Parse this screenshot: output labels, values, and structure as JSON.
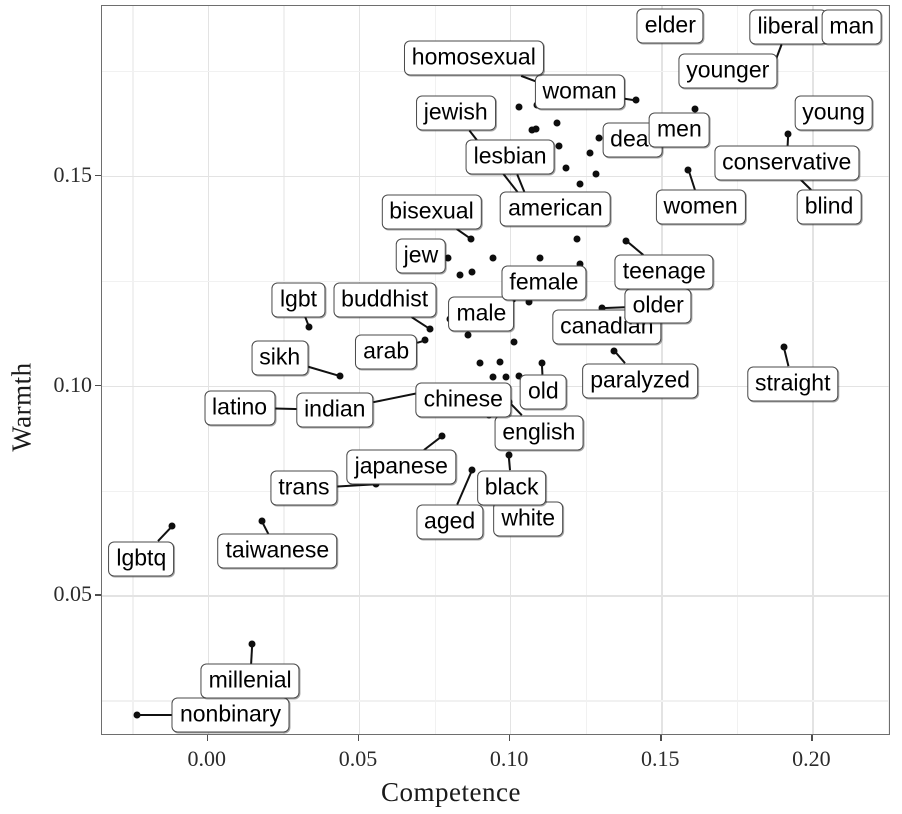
{
  "chart_data": {
    "type": "scatter",
    "title": "",
    "xlabel": "Competence",
    "ylabel": "Warmth",
    "xlim": [
      -0.035,
      0.226
    ],
    "ylim": [
      0.0165,
      0.1905
    ],
    "xticks": [
      "0.00",
      "0.05",
      "0.10",
      "0.15",
      "0.20"
    ],
    "xtick_values": [
      0.0,
      0.05,
      0.1,
      0.15,
      0.2
    ],
    "yticks": [
      "0.05",
      "0.10",
      "0.15"
    ],
    "ytick_values": [
      0.05,
      0.1,
      0.15
    ],
    "grid": "major and minor, light gray",
    "legend": "none",
    "point_color": "#0d0d0d",
    "label_box_color": "#ffffff",
    "label_border_color": "#4a4a4a",
    "points": [
      {
        "label": "nonbinary",
        "x": -0.0235,
        "y": 0.0215,
        "lx": 0.0075,
        "ly": 0.0215
      },
      {
        "label": "millenial",
        "x": 0.0147,
        "y": 0.0385,
        "lx": 0.014,
        "ly": 0.0295
      },
      {
        "label": "lgbtq",
        "x": -0.0118,
        "y": 0.0665,
        "lx": -0.022,
        "ly": 0.0588
      },
      {
        "label": "taiwanese",
        "x": 0.0178,
        "y": 0.0678,
        "lx": 0.023,
        "ly": 0.0605
      },
      {
        "label": "trans",
        "x": 0.0557,
        "y": 0.0765,
        "lx": 0.0318,
        "ly": 0.0755
      },
      {
        "label": "aged",
        "x": 0.0875,
        "y": 0.08,
        "lx": 0.08,
        "ly": 0.0675
      },
      {
        "label": "japanese",
        "x": 0.0775,
        "y": 0.088,
        "lx": 0.064,
        "ly": 0.0805
      },
      {
        "label": "white",
        "x": 0.0985,
        "y": 0.079,
        "lx": 0.106,
        "ly": 0.0682
      },
      {
        "label": "black",
        "x": 0.0995,
        "y": 0.0835,
        "lx": 0.1005,
        "ly": 0.0757
      },
      {
        "label": "english",
        "x": 0.0998,
        "y": 0.096,
        "lx": 0.1095,
        "ly": 0.0888
      },
      {
        "label": "chinese",
        "x": 0.093,
        "y": 0.093,
        "lx": 0.0845,
        "ly": 0.0965
      },
      {
        "label": "indian",
        "x": 0.0762,
        "y": 0.0992,
        "lx": 0.042,
        "ly": 0.0942
      },
      {
        "label": "latino",
        "x": 0.042,
        "y": 0.0942,
        "lx": 0.0105,
        "ly": 0.0948
      },
      {
        "label": "sikh",
        "x": 0.0437,
        "y": 0.1023,
        "lx": 0.0238,
        "ly": 0.1065
      },
      {
        "label": "lgbt",
        "x": 0.0335,
        "y": 0.114,
        "lx": 0.03,
        "ly": 0.1205
      },
      {
        "label": "arab",
        "x": 0.072,
        "y": 0.1108,
        "lx": 0.059,
        "ly": 0.108
      },
      {
        "label": "buddhist",
        "x": 0.0735,
        "y": 0.1135,
        "lx": 0.0585,
        "ly": 0.1205
      },
      {
        "label": "old",
        "x": 0.1105,
        "y": 0.1053,
        "lx": 0.111,
        "ly": 0.0985
      },
      {
        "label": "paralyzed",
        "x": 0.1345,
        "y": 0.1083,
        "lx": 0.143,
        "ly": 0.1012
      },
      {
        "label": "straight",
        "x": 0.1905,
        "y": 0.1093,
        "lx": 0.1935,
        "ly": 0.1005
      },
      {
        "label": "canadian",
        "x": 0.1165,
        "y": 0.1125,
        "lx": 0.132,
        "ly": 0.114
      },
      {
        "label": "male",
        "x": 0.0855,
        "y": 0.117,
        "lx": 0.0905,
        "ly": 0.1172
      },
      {
        "label": "female",
        "x": 0.096,
        "y": 0.1178,
        "lx": 0.1112,
        "ly": 0.1245
      },
      {
        "label": "jew",
        "x": 0.0795,
        "y": 0.1305,
        "lx": 0.0705,
        "ly": 0.131
      },
      {
        "label": "bisexual",
        "x": 0.087,
        "y": 0.135,
        "lx": 0.074,
        "ly": 0.1415
      },
      {
        "label": "older",
        "x": 0.1305,
        "y": 0.1185,
        "lx": 0.149,
        "ly": 0.119
      },
      {
        "label": "teenage",
        "x": 0.1385,
        "y": 0.1345,
        "lx": 0.151,
        "ly": 0.127
      },
      {
        "label": "american",
        "x": 0.1125,
        "y": 0.1415,
        "lx": 0.115,
        "ly": 0.142
      },
      {
        "label": "women",
        "x": 0.159,
        "y": 0.1515,
        "lx": 0.163,
        "ly": 0.1425
      },
      {
        "label": "blind",
        "x": 0.192,
        "y": 0.152,
        "lx": 0.2055,
        "ly": 0.1425
      },
      {
        "label": "conservative",
        "x": 0.192,
        "y": 0.16,
        "lx": 0.1915,
        "ly": 0.153
      },
      {
        "label": "lesbian",
        "x": 0.1072,
        "y": 0.1418,
        "lx": 0.1,
        "ly": 0.1545
      },
      {
        "label": "jewish",
        "x": 0.1072,
        "y": 0.1418,
        "lx": 0.082,
        "ly": 0.165
      },
      {
        "label": "deaf",
        "x": 0.1345,
        "y": 0.156,
        "lx": 0.1405,
        "ly": 0.1585
      },
      {
        "label": "men",
        "x": 0.154,
        "y": 0.1635,
        "lx": 0.156,
        "ly": 0.161
      },
      {
        "label": "young",
        "x": 0.1988,
        "y": 0.165,
        "lx": 0.207,
        "ly": 0.165
      },
      {
        "label": "woman",
        "x": 0.1415,
        "y": 0.168,
        "lx": 0.123,
        "ly": 0.17
      },
      {
        "label": "homosexual",
        "x": 0.1255,
        "y": 0.168,
        "lx": 0.088,
        "ly": 0.178
      },
      {
        "label": "younger",
        "x": 0.1835,
        "y": 0.175,
        "lx": 0.172,
        "ly": 0.175
      },
      {
        "label": "liberal",
        "x": 0.187,
        "y": 0.176,
        "lx": 0.192,
        "ly": 0.1855
      },
      {
        "label": "man",
        "x": 0.2135,
        "y": 0.184,
        "lx": 0.213,
        "ly": 0.1855
      },
      {
        "label": "elder",
        "x": 0.154,
        "y": 0.184,
        "lx": 0.153,
        "ly": 0.1858
      }
    ],
    "unlabeled_points": [
      {
        "x": 0.0945,
        "y": 0.102
      },
      {
        "x": 0.0985,
        "y": 0.102
      },
      {
        "x": 0.103,
        "y": 0.1022
      },
      {
        "x": 0.09,
        "y": 0.1055
      },
      {
        "x": 0.0965,
        "y": 0.1057
      },
      {
        "x": 0.1013,
        "y": 0.1105
      },
      {
        "x": 0.0862,
        "y": 0.112
      },
      {
        "x": 0.1168,
        "y": 0.113
      },
      {
        "x": 0.1063,
        "y": 0.12
      },
      {
        "x": 0.08,
        "y": 0.116
      },
      {
        "x": 0.0808,
        "y": 0.1168
      },
      {
        "x": 0.1085,
        "y": 0.1255
      },
      {
        "x": 0.0835,
        "y": 0.1265
      },
      {
        "x": 0.0875,
        "y": 0.127
      },
      {
        "x": 0.0943,
        "y": 0.1305
      },
      {
        "x": 0.11,
        "y": 0.1305
      },
      {
        "x": 0.122,
        "y": 0.135
      },
      {
        "x": 0.123,
        "y": 0.129
      },
      {
        "x": 0.1283,
        "y": 0.1505
      },
      {
        "x": 0.123,
        "y": 0.148
      },
      {
        "x": 0.1185,
        "y": 0.152
      },
      {
        "x": 0.1162,
        "y": 0.1572
      },
      {
        "x": 0.1265,
        "y": 0.1555
      },
      {
        "x": 0.1295,
        "y": 0.159
      },
      {
        "x": 0.1072,
        "y": 0.161
      },
      {
        "x": 0.1085,
        "y": 0.1612
      },
      {
        "x": 0.1155,
        "y": 0.1625
      },
      {
        "x": 0.103,
        "y": 0.1665
      },
      {
        "x": 0.109,
        "y": 0.1668
      },
      {
        "x": 0.117,
        "y": 0.1668
      },
      {
        "x": 0.161,
        "y": 0.166
      },
      {
        "x": 0.1755,
        "y": 0.1728
      },
      {
        "x": 0.2045,
        "y": 0.1822
      }
    ]
  },
  "axes": {
    "x_title": "Competence",
    "y_title": "Warmth"
  }
}
